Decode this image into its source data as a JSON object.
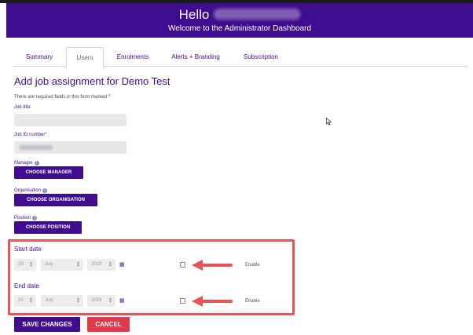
{
  "header": {
    "greeting": "Hello",
    "user_name_redacted": "",
    "welcome": "Welcome to the Administrator Dashboard"
  },
  "tabs": [
    {
      "label": "Summary",
      "active": false
    },
    {
      "label": "Users",
      "active": true
    },
    {
      "label": "Enrolments",
      "active": false
    },
    {
      "label": "Alerts + Branding",
      "active": false
    },
    {
      "label": "Subscription",
      "active": false
    }
  ],
  "form": {
    "title": "Add job assignment for Demo Test",
    "required_note": "There are required fields in this form marked",
    "required_star": "*",
    "job_title_label": "Job title",
    "job_title_value": "",
    "job_id_label": "Job ID number",
    "manager_label": "Manager",
    "choose_manager": "CHOOSE MANAGER",
    "organisation_label": "Organisation",
    "choose_organisation": "CHOOSE ORGANISATION",
    "position_label": "Position",
    "choose_position": "CHOOSE POSITION",
    "start_date": {
      "label": "Start date",
      "day": "23",
      "month": "July",
      "year": "2019",
      "enable_label": "Enable",
      "enabled": false
    },
    "end_date": {
      "label": "End date",
      "day": "23",
      "month": "July",
      "year": "2019",
      "enable_label": "Enable",
      "enabled": false
    },
    "save_label": "SAVE CHANGES",
    "cancel_label": "CANCEL"
  },
  "icons": {
    "info": "info-icon",
    "calendar": "calendar-icon",
    "chevron": "chevron-updown-icon"
  },
  "colors": {
    "brand": "#3e0c8c",
    "cancel": "#e03a4e",
    "annotation": "#e55555"
  }
}
